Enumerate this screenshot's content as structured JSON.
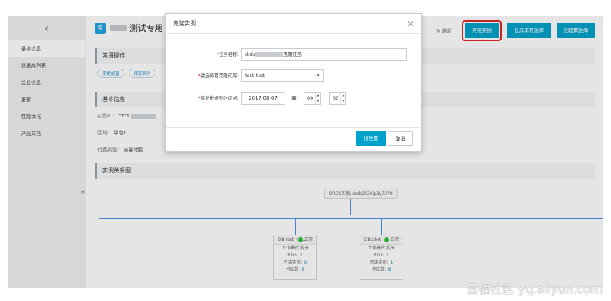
{
  "sidebar": {
    "back_icon": "chevron-left-icon",
    "items": [
      {
        "label": "基本信息"
      },
      {
        "label": "数据库列表"
      },
      {
        "label": "监控信息"
      },
      {
        "label": "报警"
      },
      {
        "label": "性能优化"
      },
      {
        "label": "产品文档"
      }
    ]
  },
  "header": {
    "title": "测试专用",
    "refresh_label": "刷新",
    "buttons": {
      "clone": "克隆实例",
      "low_cost": "低成本数据库",
      "create_db": "创建数据库"
    }
  },
  "main": {
    "ops": {
      "title": "常用操作",
      "tags": [
        "变更配置",
        "释放实例"
      ]
    },
    "basic": {
      "title": "基本信息",
      "id_label": "实例ID:",
      "id_value_prefix": "drds",
      "region_label": "区域:",
      "region_value": "华南1",
      "billing_label": "付费类型:",
      "billing_value": "按量付费"
    },
    "relation": {
      "title": "实例关系图",
      "root_label": "DRDS实例:",
      "root_value": "drds3036ip3y7370",
      "nodes": [
        {
          "name": "DB:test_tes...",
          "status": "正常",
          "mode_label": "工作模式:",
          "mode": "拆分",
          "rds_label": "RDS:",
          "rds": "1",
          "ro_label": "只读实例:",
          "ro": "0",
          "shard_label": "分库数:",
          "shard": "8"
        },
        {
          "name": "DB:abrt",
          "status": "正常",
          "mode_label": "工作模式:",
          "mode": "拆分",
          "rds_label": "RDS:",
          "rds": "1",
          "ro_label": "只读实例:",
          "ro": "1",
          "shard_label": "分库数:",
          "shard": "8"
        }
      ]
    }
  },
  "modal": {
    "title": "克隆实例",
    "close_icon": "close-icon",
    "task_label": "任务名称:",
    "task_prefix": "drds",
    "task_suffix": "克隆任务",
    "db_label": "请选择要克隆的库:",
    "db_value": "test_test",
    "time_label": "恢复数据到时间点:",
    "date_value": "2017-08-07",
    "hour_value": "09",
    "minute_value": "00",
    "precheck_label": "预检查",
    "cancel_label": "取消"
  },
  "watermark": "云栖社区 yq.aliyun.com",
  "colors": {
    "accent": "#00a2ca",
    "highlight": "#e0262a",
    "status_ok": "#2bbf3c",
    "link": "#1e8bc3"
  }
}
